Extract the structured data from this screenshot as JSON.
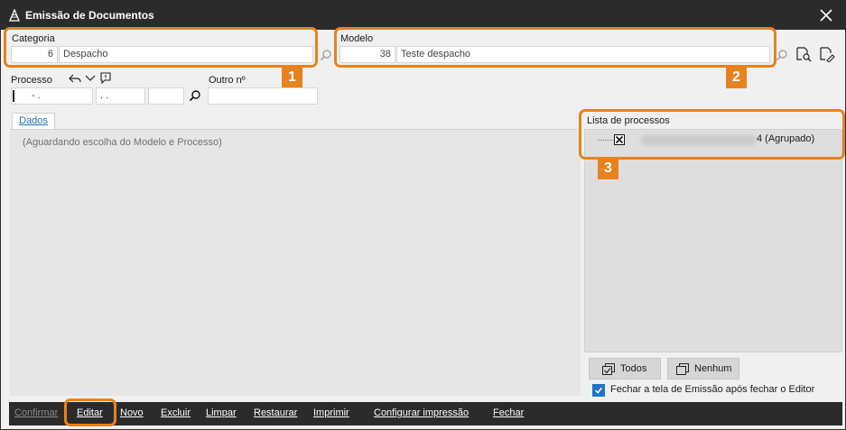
{
  "window": {
    "title": "Emissão de Documentos"
  },
  "categoria": {
    "label": "Categoria",
    "code": "6",
    "name": "Despacho"
  },
  "modelo": {
    "label": "Modelo",
    "code": "38",
    "name": "Teste despacho"
  },
  "processo": {
    "label": "Processo",
    "part1": "- .",
    "part2": ". .",
    "part3": ""
  },
  "outro": {
    "label": "Outro nº",
    "value": ""
  },
  "tabs": [
    {
      "label": "Dados"
    }
  ],
  "dados": {
    "placeholder": "(Aguardando escolha do Modelo e Processo)"
  },
  "lista": {
    "title": "Lista de processos",
    "items": [
      {
        "suffix": "4 (Agrupado)",
        "checked": true
      }
    ]
  },
  "buttons": {
    "todos": "Todos",
    "nenhum": "Nenhum"
  },
  "fechar_checkbox": {
    "label": "Fechar a tela de Emissão após fechar o Editor",
    "checked": true
  },
  "bottom": {
    "confirmar": "Confirmar",
    "editar": "Editar",
    "novo": "Novo",
    "excluir": "Excluir",
    "limpar": "Limpar",
    "restaurar": "Restaurar",
    "imprimir": "Imprimir",
    "configurar": "Configurar impressão",
    "fechar": "Fechar"
  },
  "callouts": [
    "1",
    "2",
    "3"
  ],
  "colors": {
    "accent": "#e8821e",
    "titlebar": "#2b2b2b",
    "checkbox": "#1e74c6",
    "tab_text": "#1e6fb5"
  },
  "icons": [
    "app-icon",
    "close-icon",
    "search-icon",
    "undo-icon",
    "chevron-down-icon",
    "note-icon",
    "search-doc-icon",
    "edit-doc-icon",
    "checkbox-icon",
    "check-all-icon",
    "uncheck-all-icon"
  ]
}
